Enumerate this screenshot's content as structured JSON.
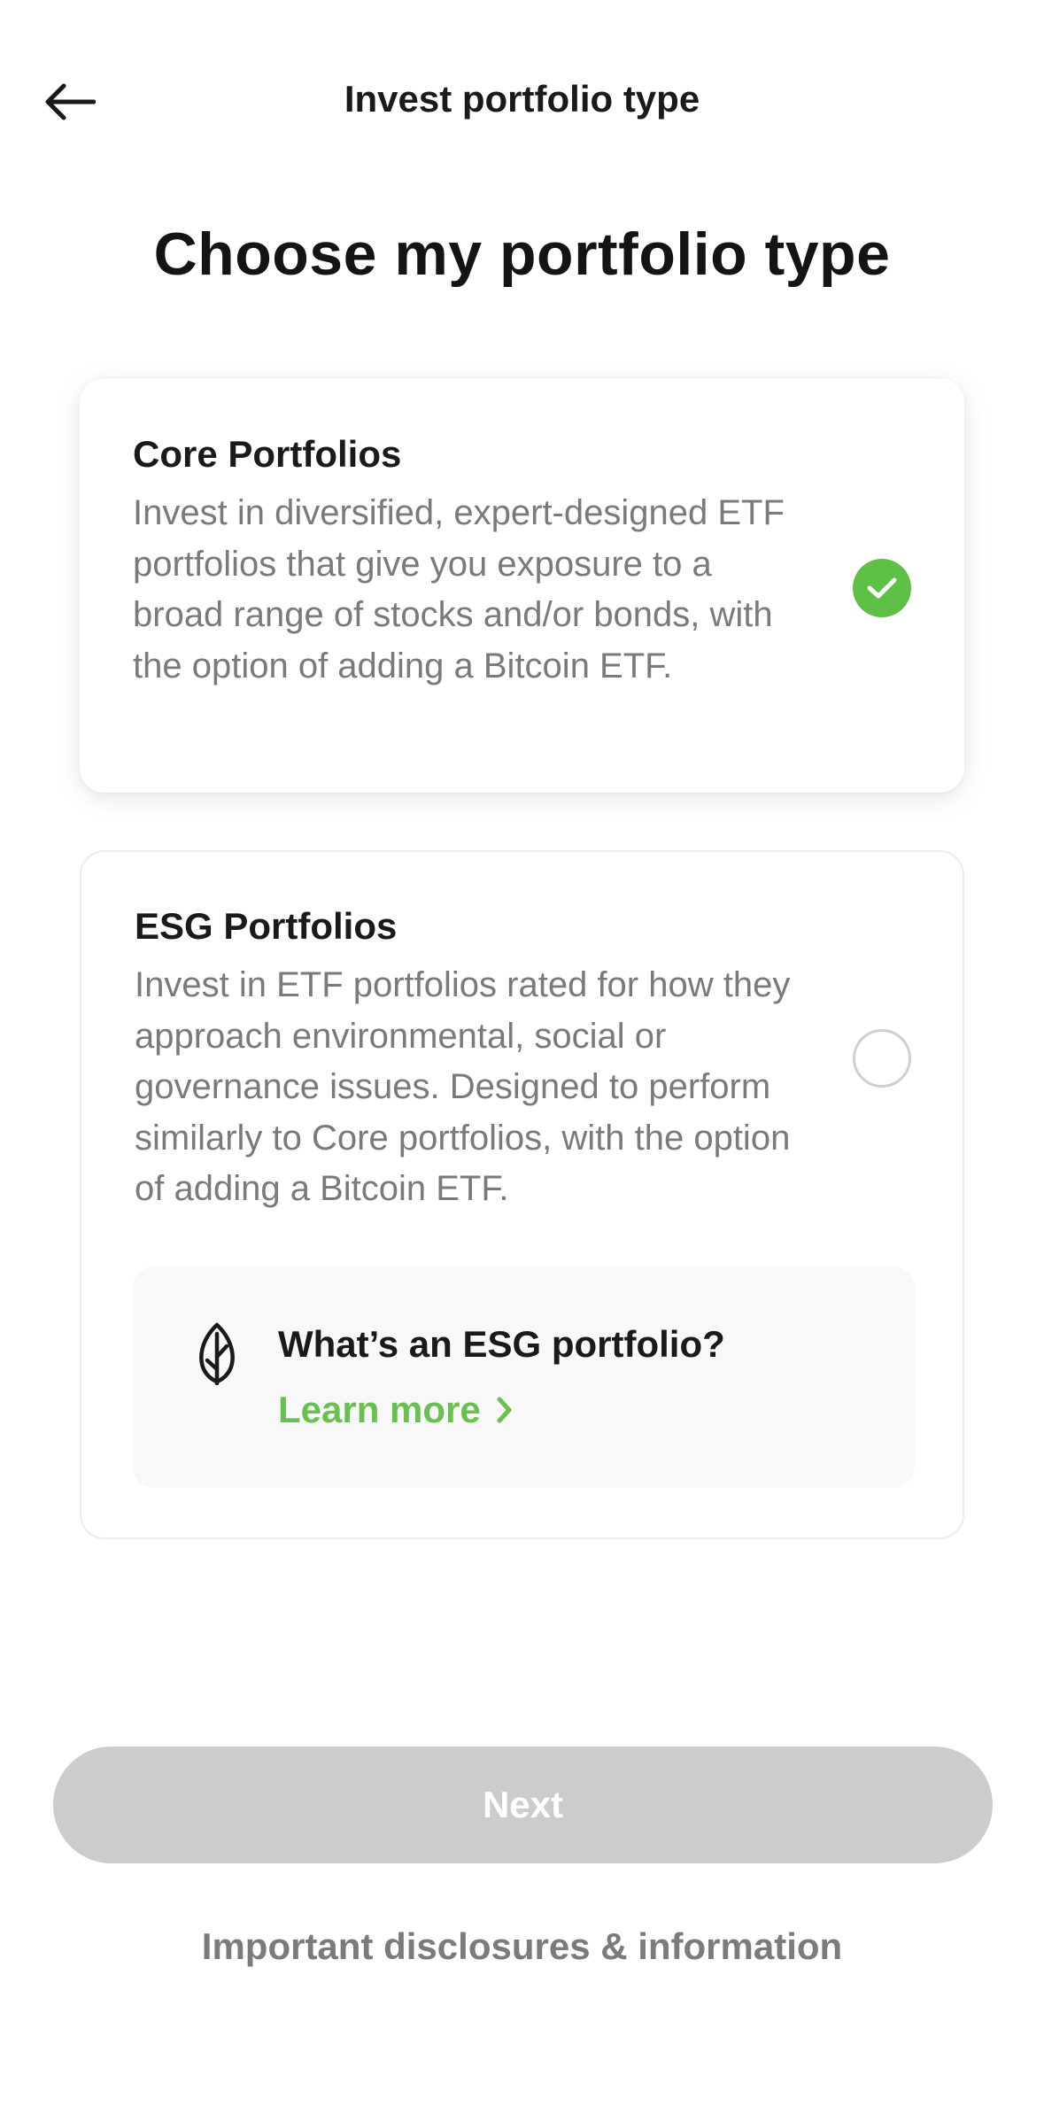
{
  "header": {
    "title": "Invest portfolio type",
    "back_icon": "arrow-left-icon"
  },
  "page_title": "Choose my portfolio type",
  "options": [
    {
      "title": "Core Portfolios",
      "description": "Invest in diversified, expert-designed ETF portfolios that give you exposure to a broad range of stocks and/or bonds, with the option of adding a Bitcoin ETF.",
      "selected": true
    },
    {
      "title": "ESG Portfolios",
      "description": "Invest in ETF portfolios rated for how they approach environmental, social or governance issues. Designed to perform similarly to Core portfolios, with the option of adding a Bitcoin ETF.",
      "selected": false
    }
  ],
  "esg_info": {
    "icon": "leaf-icon",
    "title": "What’s an ESG portfolio?",
    "link_label": "Learn more"
  },
  "next_button": {
    "label": "Next",
    "enabled": false
  },
  "disclosures_link": "Important disclosures & information",
  "colors": {
    "accent_green": "#5fc046",
    "link_green": "#68c14e",
    "disabled_button": "#cbcccc"
  }
}
